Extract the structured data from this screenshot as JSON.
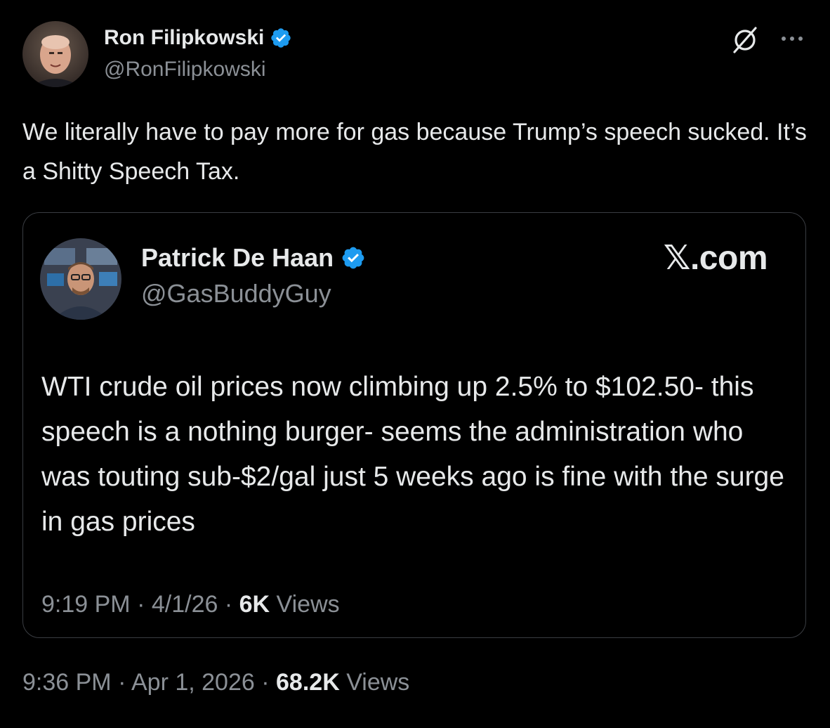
{
  "author": {
    "name": "Ron Filipkowski",
    "handle": "@RonFilipkowski",
    "verified_icon": "verified-badge-icon"
  },
  "actions": {
    "grok_icon": "grok-icon",
    "more_icon": "more-options-icon"
  },
  "tweet": {
    "text": "We literally have to pay more for gas because Trump’s speech sucked. It’s a Shitty Speech Tax.",
    "time": "9:36 PM",
    "date": "Apr 1, 2026",
    "views_count": "68.2K",
    "views_label": "Views"
  },
  "quote": {
    "name": "Patrick De Haan",
    "handle": "@GasBuddyGuy",
    "watermark": "𝕏.com",
    "text": "WTI crude oil prices now climbing up 2.5% to $102.50- this speech is a nothing burger- seems the administration who was touting sub-$2/gal just 5 weeks ago is fine with the surge in gas prices",
    "time": "9:19 PM",
    "date": "4/1/26",
    "views_count": "6K",
    "views_label": "Views"
  },
  "separator": "·",
  "colors": {
    "background": "#000000",
    "text": "#e7e9ea",
    "muted": "#8b9096",
    "verified": "#1d9bf0",
    "border": "#3a3d42"
  }
}
